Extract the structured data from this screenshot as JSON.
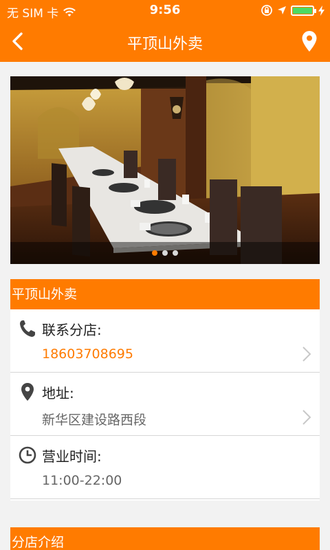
{
  "status_bar": {
    "carrier": "无 SIM 卡",
    "time": "9:56",
    "battery_level": 1.0
  },
  "nav": {
    "title": "平顶山外卖"
  },
  "banner": {
    "slide_count": 3,
    "active_slide": 0
  },
  "store": {
    "name": "平顶山外卖",
    "rows": [
      {
        "label": "联系分店:",
        "value": "18603708695",
        "icon": "phone-icon"
      },
      {
        "label": "地址:",
        "value": "新华区建设路西段",
        "icon": "location-pin-icon"
      },
      {
        "label": "营业时间:",
        "value": "11:00-22:00",
        "icon": "clock-icon"
      }
    ]
  },
  "intro": {
    "title": "分店介绍"
  },
  "colors": {
    "accent": "#ff7b00",
    "background": "#f2f2f2"
  }
}
